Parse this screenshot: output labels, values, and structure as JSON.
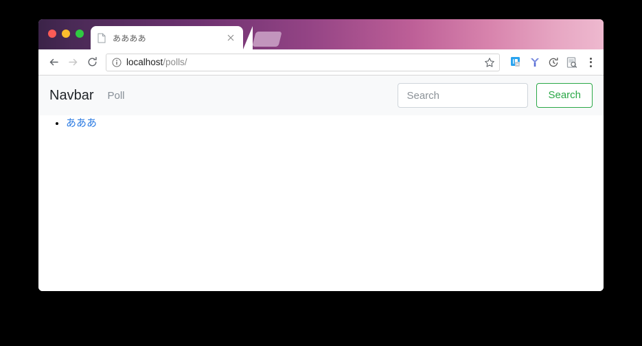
{
  "window": {
    "traffic_lights": [
      {
        "name": "close",
        "color": "#fc5b56"
      },
      {
        "name": "minimize",
        "color": "#fcbc2d"
      },
      {
        "name": "maximize",
        "color": "#2fcb42"
      }
    ],
    "titlebar_gradient_from": "#3b2348",
    "titlebar_gradient_to": "#eeb9cf"
  },
  "tabs": [
    {
      "title": "ああああ",
      "favicon": "document-icon",
      "close": "×",
      "active": true
    }
  ],
  "new_tab": {
    "label": "+"
  },
  "toolbar": {
    "back": "←",
    "forward": "→",
    "reload": "⟳",
    "security_icon": "info-circle-icon",
    "url_host": "localhost",
    "url_path": "/polls/",
    "url_full": "localhost/polls/",
    "bookmark": "☆",
    "extensions": [
      {
        "name": "clipboard-extension-icon",
        "color": "#2196f3"
      },
      {
        "name": "y-extension-icon",
        "color": "#5b6dd8"
      },
      {
        "name": "history-clock-extension-icon",
        "color": "#5a5a5a"
      },
      {
        "name": "screenshot-extension-icon",
        "color": "#9aa0a6"
      }
    ],
    "menu": "⋮"
  },
  "navbar": {
    "brand": "Navbar",
    "links": [
      {
        "label": "Poll",
        "active": false
      }
    ],
    "search": {
      "placeholder": "Search",
      "value": "",
      "button_label": "Search",
      "button_color": "#28a745"
    }
  },
  "content": {
    "polls": [
      {
        "label": "あああ",
        "link_color": "#2a7ae2"
      }
    ]
  }
}
